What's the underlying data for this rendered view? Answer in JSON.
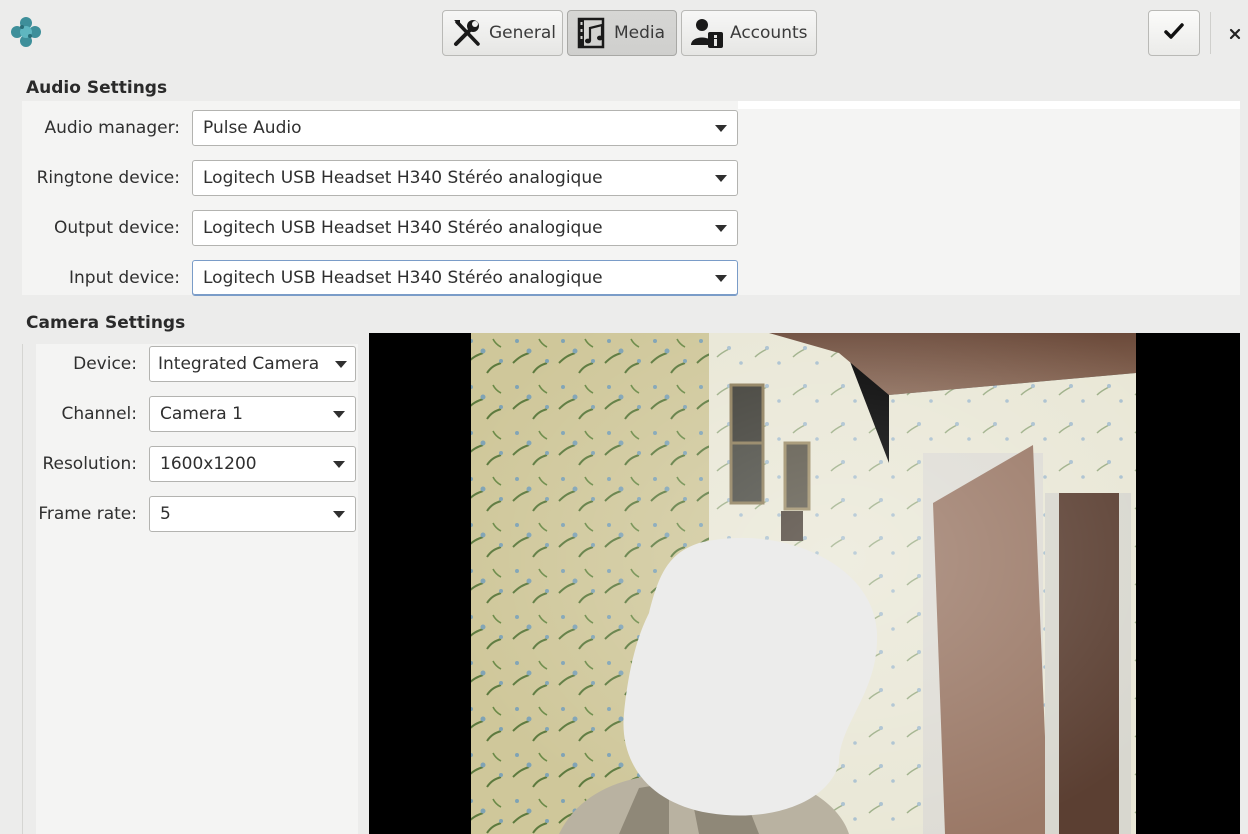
{
  "tabs": [
    {
      "label": "General",
      "icon": "wrench-screwdriver-icon",
      "active": false
    },
    {
      "label": "Media",
      "icon": "film-music-icon",
      "active": true
    },
    {
      "label": "Accounts",
      "icon": "user-id-icon",
      "active": false
    }
  ],
  "audio": {
    "title": "Audio Settings",
    "rows": [
      {
        "label": "Audio manager:",
        "value": "Pulse Audio"
      },
      {
        "label": "Ringtone device:",
        "value": "Logitech USB Headset H340 Stéréo analogique"
      },
      {
        "label": "Output device:",
        "value": "Logitech USB Headset H340 Stéréo analogique"
      },
      {
        "label": "Input device:",
        "value": "Logitech USB Headset H340 Stéréo analogique"
      }
    ]
  },
  "camera": {
    "title": "Camera Settings",
    "rows": [
      {
        "label": "Device:",
        "value": "Integrated Camera"
      },
      {
        "label": "Channel:",
        "value": "Camera 1"
      },
      {
        "label": "Resolution:",
        "value": "1600x1200"
      },
      {
        "label": "Frame rate:",
        "value": "5"
      }
    ]
  },
  "icons": {
    "app_logo": "app-logo-icon",
    "confirm": "checkmark-icon",
    "close": "close-icon"
  },
  "colors": {
    "window_bg": "#ececeb",
    "panel_bg": "#f4f4f3",
    "focus_border": "#7a9cc8"
  }
}
